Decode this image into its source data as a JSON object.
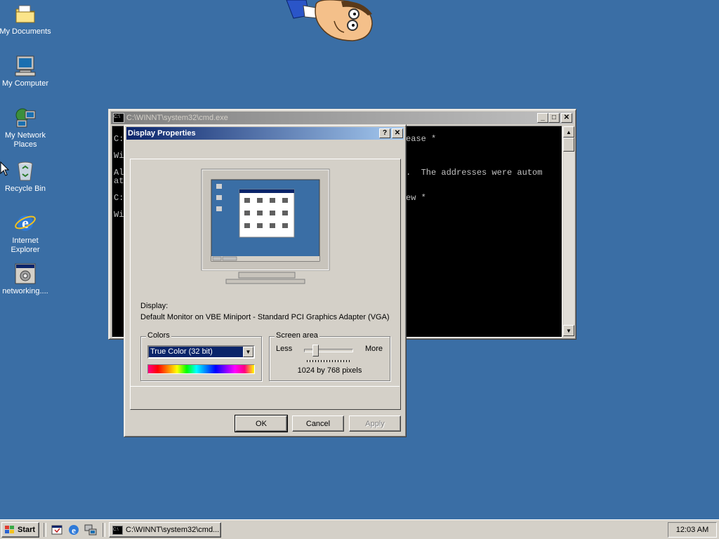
{
  "desktop": {
    "icons": [
      {
        "label": "My Documents",
        "icon": "folder-documents-icon"
      },
      {
        "label": "My Computer",
        "icon": "computer-icon"
      },
      {
        "label": "My Network Places",
        "icon": "network-places-icon"
      },
      {
        "label": "Recycle Bin",
        "icon": "recycle-bin-icon"
      },
      {
        "label": "Internet Explorer",
        "icon": "internet-explorer-icon"
      },
      {
        "label": "networking....",
        "icon": "program-shortcut-icon"
      }
    ],
    "background_color": "#3a6ea5"
  },
  "cmd_window": {
    "title": "C:\\WINNT\\system32\\cmd.exe",
    "lines": [
      {
        "left": "C:",
        "right": "ease *"
      },
      {
        "left": "Wi",
        "right": ""
      },
      {
        "left": "Al",
        "right": ".  The addresses were autom"
      },
      {
        "left": "at",
        "right": ""
      },
      {
        "left": "C:",
        "right": "ew *"
      },
      {
        "left": "Wi",
        "right": ""
      }
    ]
  },
  "display_properties": {
    "title": "Display Properties",
    "display_label": "Display:",
    "display_value": "Default Monitor on VBE Miniport - Standard PCI Graphics Adapter (VGA)",
    "colors": {
      "group_label": "Colors",
      "selected": "True Color (32 bit)"
    },
    "screen_area": {
      "group_label": "Screen area",
      "less_label": "Less",
      "more_label": "More",
      "resolution": "1024 by 768 pixels",
      "slider_position": 0.2
    },
    "buttons": {
      "ok": "OK",
      "cancel": "Cancel",
      "apply": "Apply"
    }
  },
  "taskbar": {
    "start_label": "Start",
    "task_label": "C:\\WINNT\\system32\\cmd...",
    "clock": "12:03 AM"
  }
}
